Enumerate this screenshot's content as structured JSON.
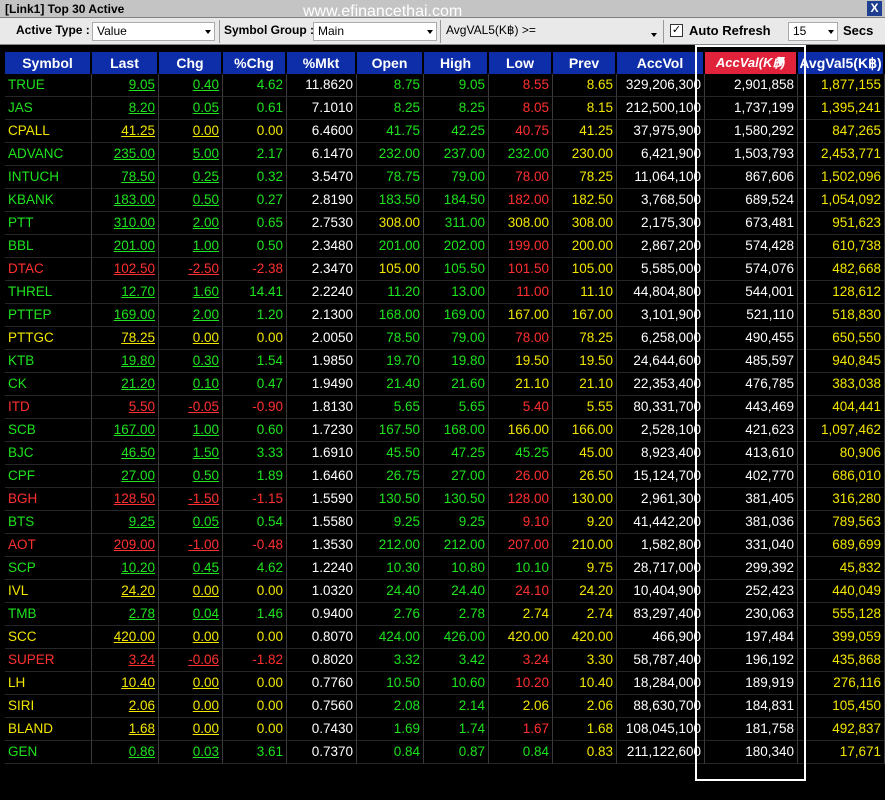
{
  "window": {
    "title": "[Link1] Top 30 Active",
    "watermark": "www.efinancethai.com",
    "close_label": "X"
  },
  "toolbar": {
    "active_type_label": "Active Type :",
    "active_type_value": "Value",
    "symbol_group_label": "Symbol Group :",
    "symbol_group_value": "Main",
    "avgval_filter": "AvgVAL5(K฿) >=",
    "auto_refresh_label": "Auto Refresh",
    "auto_refresh_checked": true,
    "refresh_interval": "15",
    "secs_label": "Secs"
  },
  "table": {
    "sorted_column": "AccVal(K฿)",
    "columns": [
      "Symbol",
      "Last",
      "Chg",
      "%Chg",
      "%Mkt",
      "Open",
      "High",
      "Low",
      "Prev",
      "AccVol",
      "AccVal(K฿)",
      "AvgVal5(K฿)"
    ],
    "rows": [
      {
        "symbol": "TRUE",
        "last": "9.05",
        "chg": "0.40",
        "pchg": "4.62",
        "pmkt": "11.8620",
        "open": "8.75",
        "high": "9.05",
        "low": "8.55",
        "prev": "8.65",
        "accvol": "329,206,300",
        "accval": "2,901,858",
        "avgval5": "1,877,155",
        "dir": "up",
        "open_c": "green",
        "high_c": "green",
        "low_c": "red"
      },
      {
        "symbol": "JAS",
        "last": "8.20",
        "chg": "0.05",
        "pchg": "0.61",
        "pmkt": "7.1010",
        "open": "8.25",
        "high": "8.25",
        "low": "8.05",
        "prev": "8.15",
        "accvol": "212,500,100",
        "accval": "1,737,199",
        "avgval5": "1,395,241",
        "dir": "up",
        "open_c": "green",
        "high_c": "green",
        "low_c": "red"
      },
      {
        "symbol": "CPALL",
        "last": "41.25",
        "chg": "0.00",
        "pchg": "0.00",
        "pmkt": "6.4600",
        "open": "41.75",
        "high": "42.25",
        "low": "40.75",
        "prev": "41.25",
        "accvol": "37,975,900",
        "accval": "1,580,292",
        "avgval5": "847,265",
        "dir": "flat",
        "open_c": "green",
        "high_c": "green",
        "low_c": "red"
      },
      {
        "symbol": "ADVANC",
        "last": "235.00",
        "chg": "5.00",
        "pchg": "2.17",
        "pmkt": "6.1470",
        "open": "232.00",
        "high": "237.00",
        "low": "232.00",
        "prev": "230.00",
        "accvol": "6,421,900",
        "accval": "1,503,793",
        "avgval5": "2,453,771",
        "dir": "up",
        "open_c": "green",
        "high_c": "green",
        "low_c": "green"
      },
      {
        "symbol": "INTUCH",
        "last": "78.50",
        "chg": "0.25",
        "pchg": "0.32",
        "pmkt": "3.5470",
        "open": "78.75",
        "high": "79.00",
        "low": "78.00",
        "prev": "78.25",
        "accvol": "11,064,100",
        "accval": "867,606",
        "avgval5": "1,502,096",
        "dir": "up",
        "open_c": "green",
        "high_c": "green",
        "low_c": "red"
      },
      {
        "symbol": "KBANK",
        "last": "183.00",
        "chg": "0.50",
        "pchg": "0.27",
        "pmkt": "2.8190",
        "open": "183.50",
        "high": "184.50",
        "low": "182.00",
        "prev": "182.50",
        "accvol": "3,768,500",
        "accval": "689,524",
        "avgval5": "1,054,092",
        "dir": "up",
        "open_c": "green",
        "high_c": "green",
        "low_c": "red"
      },
      {
        "symbol": "PTT",
        "last": "310.00",
        "chg": "2.00",
        "pchg": "0.65",
        "pmkt": "2.7530",
        "open": "308.00",
        "high": "311.00",
        "low": "308.00",
        "prev": "308.00",
        "accvol": "2,175,300",
        "accval": "673,481",
        "avgval5": "951,623",
        "dir": "up",
        "open_c": "yellow",
        "high_c": "green",
        "low_c": "yellow"
      },
      {
        "symbol": "BBL",
        "last": "201.00",
        "chg": "1.00",
        "pchg": "0.50",
        "pmkt": "2.3480",
        "open": "201.00",
        "high": "202.00",
        "low": "199.00",
        "prev": "200.00",
        "accvol": "2,867,200",
        "accval": "574,428",
        "avgval5": "610,738",
        "dir": "up",
        "open_c": "green",
        "high_c": "green",
        "low_c": "red"
      },
      {
        "symbol": "DTAC",
        "last": "102.50",
        "chg": "-2.50",
        "pchg": "-2.38",
        "pmkt": "2.3470",
        "open": "105.00",
        "high": "105.50",
        "low": "101.50",
        "prev": "105.00",
        "accvol": "5,585,000",
        "accval": "574,076",
        "avgval5": "482,668",
        "dir": "down",
        "open_c": "yellow",
        "high_c": "green",
        "low_c": "red"
      },
      {
        "symbol": "THREL",
        "last": "12.70",
        "chg": "1.60",
        "pchg": "14.41",
        "pmkt": "2.2240",
        "open": "11.20",
        "high": "13.00",
        "low": "11.00",
        "prev": "11.10",
        "accvol": "44,804,800",
        "accval": "544,001",
        "avgval5": "128,612",
        "dir": "up",
        "open_c": "green",
        "high_c": "green",
        "low_c": "red"
      },
      {
        "symbol": "PTTEP",
        "last": "169.00",
        "chg": "2.00",
        "pchg": "1.20",
        "pmkt": "2.1300",
        "open": "168.00",
        "high": "169.00",
        "low": "167.00",
        "prev": "167.00",
        "accvol": "3,101,900",
        "accval": "521,110",
        "avgval5": "518,830",
        "dir": "up",
        "open_c": "green",
        "high_c": "green",
        "low_c": "yellow"
      },
      {
        "symbol": "PTTGC",
        "last": "78.25",
        "chg": "0.00",
        "pchg": "0.00",
        "pmkt": "2.0050",
        "open": "78.50",
        "high": "79.00",
        "low": "78.00",
        "prev": "78.25",
        "accvol": "6,258,000",
        "accval": "490,455",
        "avgval5": "650,550",
        "dir": "flat",
        "open_c": "green",
        "high_c": "green",
        "low_c": "red"
      },
      {
        "symbol": "KTB",
        "last": "19.80",
        "chg": "0.30",
        "pchg": "1.54",
        "pmkt": "1.9850",
        "open": "19.70",
        "high": "19.80",
        "low": "19.50",
        "prev": "19.50",
        "accvol": "24,644,600",
        "accval": "485,597",
        "avgval5": "940,845",
        "dir": "up",
        "open_c": "green",
        "high_c": "green",
        "low_c": "yellow"
      },
      {
        "symbol": "CK",
        "last": "21.20",
        "chg": "0.10",
        "pchg": "0.47",
        "pmkt": "1.9490",
        "open": "21.40",
        "high": "21.60",
        "low": "21.10",
        "prev": "21.10",
        "accvol": "22,353,400",
        "accval": "476,785",
        "avgval5": "383,038",
        "dir": "up",
        "open_c": "green",
        "high_c": "green",
        "low_c": "yellow"
      },
      {
        "symbol": "ITD",
        "last": "5.50",
        "chg": "-0.05",
        "pchg": "-0.90",
        "pmkt": "1.8130",
        "open": "5.65",
        "high": "5.65",
        "low": "5.40",
        "prev": "5.55",
        "accvol": "80,331,700",
        "accval": "443,469",
        "avgval5": "404,441",
        "dir": "down",
        "open_c": "green",
        "high_c": "green",
        "low_c": "red"
      },
      {
        "symbol": "SCB",
        "last": "167.00",
        "chg": "1.00",
        "pchg": "0.60",
        "pmkt": "1.7230",
        "open": "167.50",
        "high": "168.00",
        "low": "166.00",
        "prev": "166.00",
        "accvol": "2,528,100",
        "accval": "421,623",
        "avgval5": "1,097,462",
        "dir": "up",
        "open_c": "green",
        "high_c": "green",
        "low_c": "yellow"
      },
      {
        "symbol": "BJC",
        "last": "46.50",
        "chg": "1.50",
        "pchg": "3.33",
        "pmkt": "1.6910",
        "open": "45.50",
        "high": "47.25",
        "low": "45.25",
        "prev": "45.00",
        "accvol": "8,923,400",
        "accval": "413,610",
        "avgval5": "80,906",
        "dir": "up",
        "open_c": "green",
        "high_c": "green",
        "low_c": "green"
      },
      {
        "symbol": "CPF",
        "last": "27.00",
        "chg": "0.50",
        "pchg": "1.89",
        "pmkt": "1.6460",
        "open": "26.75",
        "high": "27.00",
        "low": "26.00",
        "prev": "26.50",
        "accvol": "15,124,700",
        "accval": "402,770",
        "avgval5": "686,010",
        "dir": "up",
        "open_c": "green",
        "high_c": "green",
        "low_c": "red"
      },
      {
        "symbol": "BGH",
        "last": "128.50",
        "chg": "-1.50",
        "pchg": "-1.15",
        "pmkt": "1.5590",
        "open": "130.50",
        "high": "130.50",
        "low": "128.00",
        "prev": "130.00",
        "accvol": "2,961,300",
        "accval": "381,405",
        "avgval5": "316,280",
        "dir": "down",
        "open_c": "green",
        "high_c": "green",
        "low_c": "red"
      },
      {
        "symbol": "BTS",
        "last": "9.25",
        "chg": "0.05",
        "pchg": "0.54",
        "pmkt": "1.5580",
        "open": "9.25",
        "high": "9.25",
        "low": "9.10",
        "prev": "9.20",
        "accvol": "41,442,200",
        "accval": "381,036",
        "avgval5": "789,563",
        "dir": "up",
        "open_c": "green",
        "high_c": "green",
        "low_c": "red"
      },
      {
        "symbol": "AOT",
        "last": "209.00",
        "chg": "-1.00",
        "pchg": "-0.48",
        "pmkt": "1.3530",
        "open": "212.00",
        "high": "212.00",
        "low": "207.00",
        "prev": "210.00",
        "accvol": "1,582,800",
        "accval": "331,040",
        "avgval5": "689,699",
        "dir": "down",
        "open_c": "green",
        "high_c": "green",
        "low_c": "red"
      },
      {
        "symbol": "SCP",
        "last": "10.20",
        "chg": "0.45",
        "pchg": "4.62",
        "pmkt": "1.2240",
        "open": "10.30",
        "high": "10.80",
        "low": "10.10",
        "prev": "9.75",
        "accvol": "28,717,000",
        "accval": "299,392",
        "avgval5": "45,832",
        "dir": "up",
        "open_c": "green",
        "high_c": "green",
        "low_c": "green"
      },
      {
        "symbol": "IVL",
        "last": "24.20",
        "chg": "0.00",
        "pchg": "0.00",
        "pmkt": "1.0320",
        "open": "24.40",
        "high": "24.40",
        "low": "24.10",
        "prev": "24.20",
        "accvol": "10,404,900",
        "accval": "252,423",
        "avgval5": "440,049",
        "dir": "flat",
        "open_c": "green",
        "high_c": "green",
        "low_c": "red"
      },
      {
        "symbol": "TMB",
        "last": "2.78",
        "chg": "0.04",
        "pchg": "1.46",
        "pmkt": "0.9400",
        "open": "2.76",
        "high": "2.78",
        "low": "2.74",
        "prev": "2.74",
        "accvol": "83,297,400",
        "accval": "230,063",
        "avgval5": "555,128",
        "dir": "up",
        "open_c": "green",
        "high_c": "green",
        "low_c": "yellow"
      },
      {
        "symbol": "SCC",
        "last": "420.00",
        "chg": "0.00",
        "pchg": "0.00",
        "pmkt": "0.8070",
        "open": "424.00",
        "high": "426.00",
        "low": "420.00",
        "prev": "420.00",
        "accvol": "466,900",
        "accval": "197,484",
        "avgval5": "399,059",
        "dir": "flat",
        "open_c": "green",
        "high_c": "green",
        "low_c": "yellow"
      },
      {
        "symbol": "SUPER",
        "last": "3.24",
        "chg": "-0.06",
        "pchg": "-1.82",
        "pmkt": "0.8020",
        "open": "3.32",
        "high": "3.42",
        "low": "3.24",
        "prev": "3.30",
        "accvol": "58,787,400",
        "accval": "196,192",
        "avgval5": "435,868",
        "dir": "down",
        "open_c": "green",
        "high_c": "green",
        "low_c": "red"
      },
      {
        "symbol": "LH",
        "last": "10.40",
        "chg": "0.00",
        "pchg": "0.00",
        "pmkt": "0.7760",
        "open": "10.50",
        "high": "10.60",
        "low": "10.20",
        "prev": "10.40",
        "accvol": "18,284,000",
        "accval": "189,919",
        "avgval5": "276,116",
        "dir": "flat",
        "open_c": "green",
        "high_c": "green",
        "low_c": "red"
      },
      {
        "symbol": "SIRI",
        "last": "2.06",
        "chg": "0.00",
        "pchg": "0.00",
        "pmkt": "0.7560",
        "open": "2.08",
        "high": "2.14",
        "low": "2.06",
        "prev": "2.06",
        "accvol": "88,630,700",
        "accval": "184,831",
        "avgval5": "105,450",
        "dir": "flat",
        "open_c": "green",
        "high_c": "green",
        "low_c": "yellow"
      },
      {
        "symbol": "BLAND",
        "last": "1.68",
        "chg": "0.00",
        "pchg": "0.00",
        "pmkt": "0.7430",
        "open": "1.69",
        "high": "1.74",
        "low": "1.67",
        "prev": "1.68",
        "accvol": "108,045,100",
        "accval": "181,758",
        "avgval5": "492,837",
        "dir": "flat",
        "open_c": "green",
        "high_c": "green",
        "low_c": "red"
      },
      {
        "symbol": "GEN",
        "last": "0.86",
        "chg": "0.03",
        "pchg": "3.61",
        "pmkt": "0.7370",
        "open": "0.84",
        "high": "0.87",
        "low": "0.84",
        "prev": "0.83",
        "accvol": "211,122,600",
        "accval": "180,340",
        "avgval5": "17,671",
        "dir": "up",
        "open_c": "green",
        "high_c": "green",
        "low_c": "green"
      }
    ]
  }
}
